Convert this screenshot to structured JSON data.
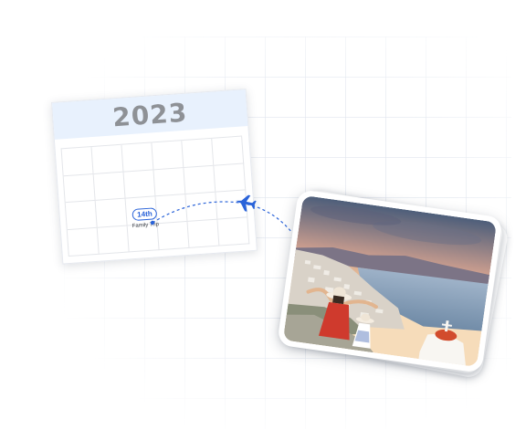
{
  "calendar": {
    "year": "2023",
    "event": {
      "date_label": "14th",
      "name": "Family Trip"
    }
  },
  "icons": {
    "flight": "airplane-icon"
  },
  "colors": {
    "accent": "#2a63d9",
    "calendar_header": "#e8f1fd",
    "year_text": "#8e9196"
  },
  "photo": {
    "subject": "photo-mykonos"
  }
}
